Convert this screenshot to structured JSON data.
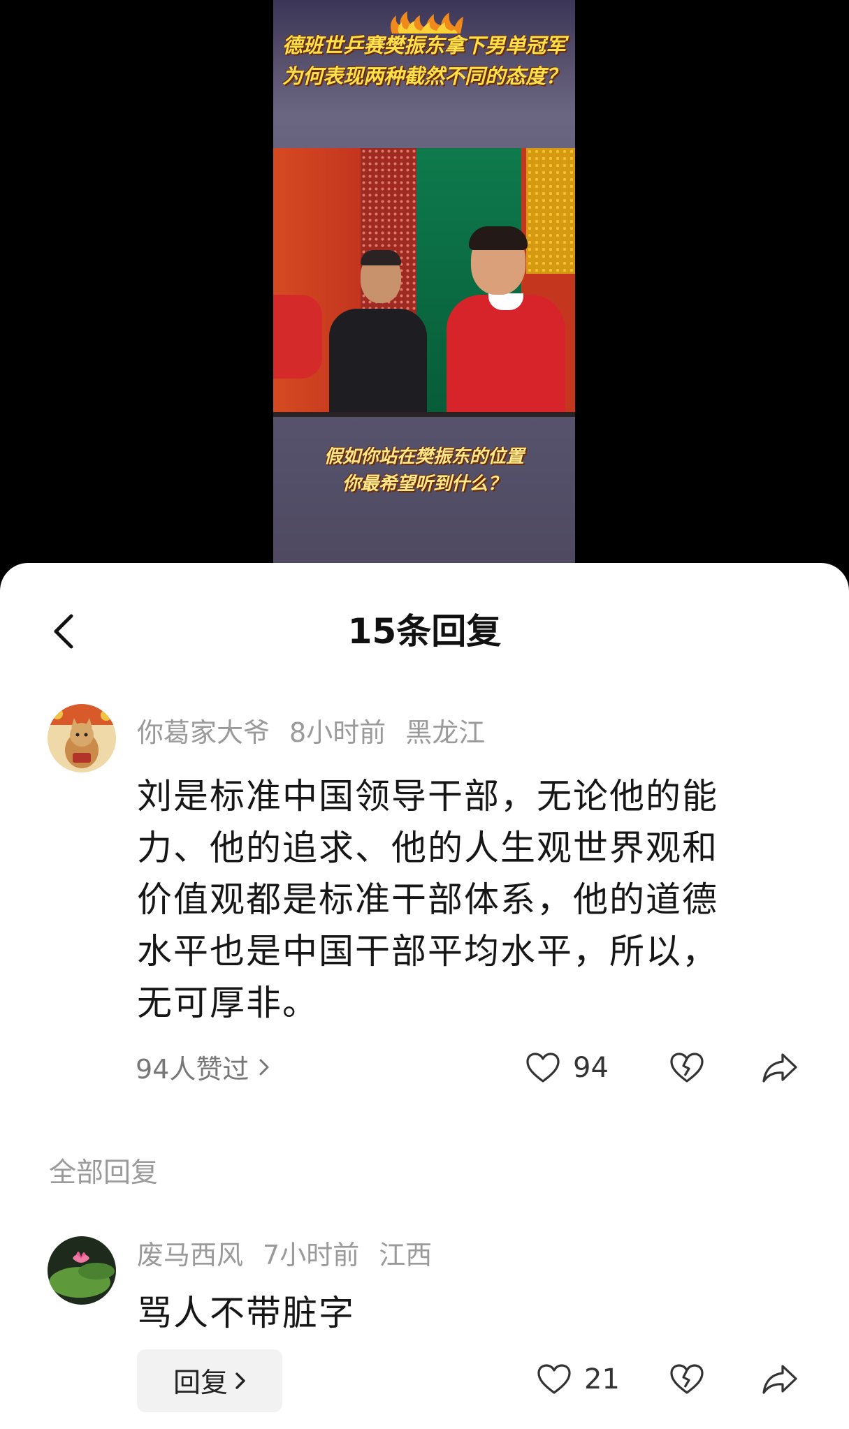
{
  "video": {
    "caption_top": [
      "德班世乒赛樊振东拿下男单冠军",
      "为何表现两种截然不同的态度？"
    ],
    "caption_bottom": [
      "假如你站在樊振东的位置",
      "你最希望听到什么？"
    ]
  },
  "panel": {
    "title": "15条回复",
    "back_icon": "chevron-left-icon"
  },
  "main_comment": {
    "author": "你葛家大爷",
    "time": "8小时前",
    "location": "黑龙江",
    "text_lines": [
      "刘是标准中国领导干部，无论他的能",
      "力、他的追求、他的人生观世界观和",
      "价值观都是标准干部体系，他的道德",
      "水平也是中国干部平均水平，所以，",
      "无可厚非。"
    ],
    "likers_label": "94人赞过",
    "like_count": "94"
  },
  "section": {
    "all_replies_label": "全部回复"
  },
  "reply": {
    "author": "废马西风",
    "time": "7小时前",
    "location": "江西",
    "text": "骂人不带脏字",
    "reply_button_label": "回复",
    "like_count": "21"
  },
  "colors": {
    "caption": "#ffe14a",
    "meta": "#9a9a9a",
    "text": "#161616"
  }
}
